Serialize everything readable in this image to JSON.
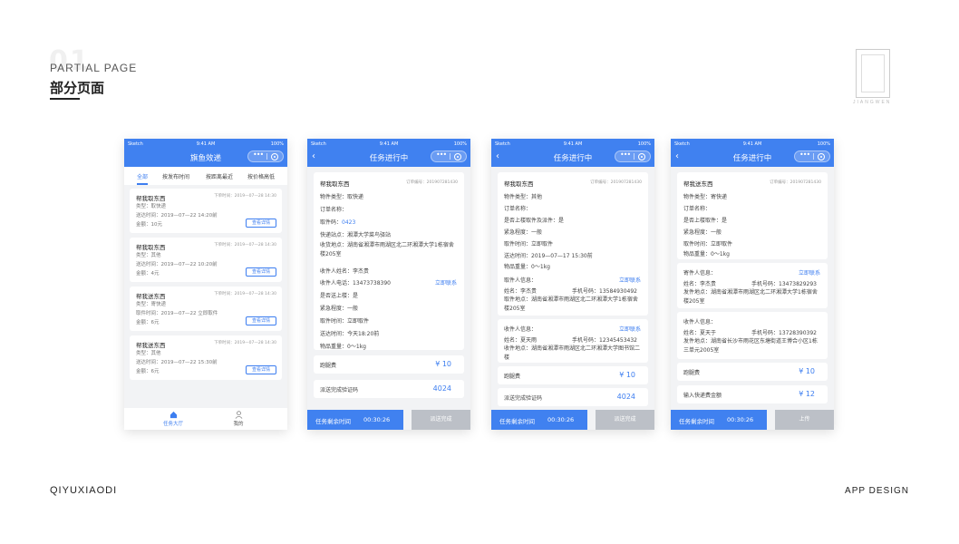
{
  "header": {
    "big_number": "01",
    "partial_page": "PARTIAL PAGE",
    "title": "部分页面"
  },
  "logo": {
    "caption": "JIANGWEN"
  },
  "footer": {
    "left": "QIYUXIAODI",
    "right": "APP DESIGN"
  },
  "colors": {
    "primary": "#4081f0",
    "disabled": "#bcc0c7",
    "background": "#f2f3f5"
  },
  "status_bar": {
    "carrier": "Sketch",
    "time": "9:41 AM",
    "battery": "100%"
  },
  "screen1": {
    "title": "旗鱼效递",
    "tabs": [
      "全部",
      "按发布时间",
      "按距离最近",
      "按价格高低"
    ],
    "orders": [
      {
        "title": "帮我取东西",
        "time": "下单时间：2019—07—28 14:30",
        "type": "类型：取快递",
        "when": "送达时间：2019—07—22 14:20前",
        "amount": "金额：10元",
        "button": "查看详情"
      },
      {
        "title": "帮我取东西",
        "time": "下单时间：2019—07—28 14:30",
        "type": "类型：其他",
        "when": "送达时间：2019—07—22 10:20前",
        "amount": "金额：4元",
        "button": "查看详情"
      },
      {
        "title": "帮我送东西",
        "time": "下单时间：2019—07—28 14:30",
        "type": "类型：寄快递",
        "when": "取件时间：2019—07—22 立即取件",
        "amount": "金额：6元",
        "button": "查看详情"
      },
      {
        "title": "帮我送东西",
        "time": "下单时间：2019—07—28 14:30",
        "type": "类型：其他",
        "when": "送达时间：2019—07—22 15:30前",
        "amount": "金额：6元",
        "button": "查看详情"
      }
    ],
    "nav": [
      {
        "label": "任务大厅",
        "icon": "home-icon"
      },
      {
        "label": "我的",
        "icon": "user-icon"
      }
    ]
  },
  "screen2": {
    "title": "任务进行中",
    "card_title": "帮我取东西",
    "order_no": "订单编号：201907281430",
    "rows": {
      "item_type": "物件类型：取快递",
      "order_name": "订单名称：",
      "pickup_code_label": "取件码：",
      "pickup_code_value": "0423",
      "station": "快递站点：湘潭大学菜鸟驿站",
      "address": "收货地点：湖南省湘潭市雨湖区北二环湘潭大学1栋宿舍楼205室",
      "receiver": "收件人姓名：李杰贵",
      "phone": "收件人电话：13473738390",
      "contact": "立即联系",
      "upstairs": "是否送上楼：是",
      "urgency": "紧急程度：一般",
      "pickup_time": "取件时间：立即取件",
      "deliver_time": "送达时间：今天18:20前",
      "weight": "物品重量：0～1kg"
    },
    "fee_label": "跑腿费",
    "fee_value": "¥ 10",
    "code_label": "派送完成验证码",
    "code_value": "4024",
    "timer_label": "任务剩余时间",
    "timer_value": "00:30:26",
    "action": "派送完成"
  },
  "screen3": {
    "title": "任务进行中",
    "card_title": "帮我取东西",
    "order_no": "订单编号：201907281430",
    "rows": {
      "item_type": "物件类型：其他",
      "order_name": "订单名称：",
      "upstairs": "是否上楼取件及派件：是",
      "urgency": "紧急程度：一般",
      "pickup_time": "取件时间：立即取件",
      "deliver_time": "送达时间：2019—07—17 15:30前",
      "weight": "物品重量：0～1kg"
    },
    "pickup": {
      "label": "取件人信息：",
      "contact": "立即联系",
      "name": "姓名：李杰贵",
      "phone": "手机号码：13584930492",
      "address": "取件地点：湖南省湘潭市雨湖区北二环湘潭大学1栋宿舍楼205室"
    },
    "receiver": {
      "label": "收件人信息：",
      "contact": "立即联系",
      "name": "姓名：夏天雨",
      "phone": "手机号码：12345453432",
      "address": "收件地点：湖南省湘潭市雨湖区北二环湘潭大学图书馆二楼"
    },
    "fee_label": "跑腿费",
    "fee_value": "¥ 10",
    "code_label": "派送完成验证码",
    "code_value": "4024",
    "timer_label": "任务剩余时间",
    "timer_value": "00:30:26",
    "action": "派送完成"
  },
  "screen4": {
    "title": "任务进行中",
    "card_title": "帮我送东西",
    "order_no": "订单编号：201907281430",
    "rows": {
      "item_type": "物件类型：寄快递",
      "order_name": "订单名称：",
      "upstairs": "是否上楼取件：是",
      "urgency": "紧急程度：一般",
      "pickup_time": "取件时间：立即取件",
      "weight": "物品重量：0～1kg"
    },
    "sender": {
      "label": "寄件人信息：",
      "contact": "立即联系",
      "name": "姓名：李杰贵",
      "phone": "手机号码：13473829293",
      "address": "发件地点：湖南省湘潭市雨湖区北二环湘潭大学1栋宿舍楼205室"
    },
    "receiver": {
      "label": "收件人信息：",
      "name": "姓名：夏天于",
      "phone": "手机号码：13728390392",
      "address": "发件地点：湖南省长沙市雨花区东塘街道王博合小区1栋三单元2005室"
    },
    "fee_label": "跑腿费",
    "fee_value": "¥ 10",
    "input_label": "输入快递费金额",
    "input_value": "¥ 12",
    "timer_label": "任务剩余时间",
    "timer_value": "00:30:26",
    "action": "上传"
  }
}
